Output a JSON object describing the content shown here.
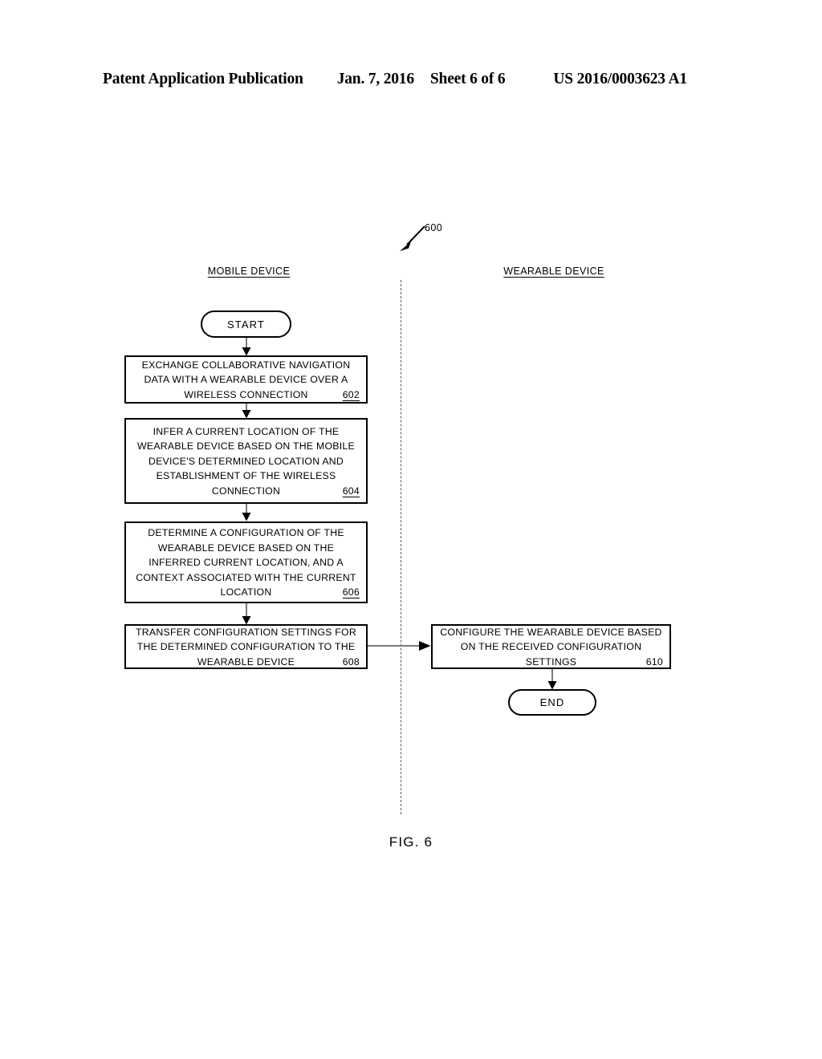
{
  "page_header": {
    "publication": "Patent Application Publication",
    "date": "Jan. 7, 2016",
    "sheet": "Sheet 6 of 6",
    "publication_number": "US 2016/0003623 A1"
  },
  "figure": {
    "caption": "FIG. 6",
    "reference_numeral": "600",
    "colors": {
      "stroke": "#000000",
      "connector": "#7a7a7a",
      "divider": "#5b5b5b",
      "background": "#ffffff"
    }
  },
  "lanes": [
    {
      "id": "mobile",
      "title": "MOBILE DEVICE"
    },
    {
      "id": "wearable",
      "title": "WEARABLE DEVICE"
    }
  ],
  "terminals": {
    "start": "START",
    "end": "END"
  },
  "steps": [
    {
      "ref": "602",
      "lane": "mobile",
      "lines": [
        "EXCHANGE COLLABORATIVE NAVIGATION",
        "DATA WITH A WEARABLE DEVICE OVER A"
      ],
      "last_line": "WIRELESS CONNECTION",
      "full_text": "EXCHANGE COLLABORATIVE NAVIGATION DATA WITH A WEARABLE DEVICE OVER A WIRELESS CONNECTION"
    },
    {
      "ref": "604",
      "lane": "mobile",
      "lines": [
        "INFER A CURRENT LOCATION OF THE",
        "WEARABLE DEVICE BASED ON THE MOBILE",
        "DEVICE'S DETERMINED LOCATION AND",
        "ESTABLISHMENT OF THE WIRELESS"
      ],
      "last_line": "CONNECTION",
      "full_text": "INFER A CURRENT LOCATION OF THE WEARABLE DEVICE BASED ON THE MOBILE DEVICE'S DETERMINED LOCATION AND ESTABLISHMENT OF THE WIRELESS CONNECTION"
    },
    {
      "ref": "606",
      "lane": "mobile",
      "lines": [
        "DETERMINE A CONFIGURATION OF THE",
        "WEARABLE DEVICE BASED ON THE",
        "INFERRED CURRENT LOCATION, AND A",
        "CONTEXT ASSOCIATED WITH THE CURRENT"
      ],
      "last_line": "LOCATION",
      "full_text": "DETERMINE A CONFIGURATION OF THE WEARABLE DEVICE BASED ON THE INFERRED CURRENT LOCATION, AND A CONTEXT ASSOCIATED WITH THE CURRENT LOCATION"
    },
    {
      "ref": "608",
      "lane": "mobile",
      "lines": [
        "TRANSFER CONFIGURATION SETTINGS FOR",
        "THE DETERMINED CONFIGURATION TO THE"
      ],
      "last_line": "WEARABLE DEVICE",
      "full_text": "TRANSFER CONFIGURATION SETTINGS FOR THE DETERMINED CONFIGURATION TO THE WEARABLE DEVICE"
    },
    {
      "ref": "610",
      "lane": "wearable",
      "lines": [
        "CONFIGURE THE WEARABLE DEVICE BASED",
        "ON THE RECEIVED CONFIGURATION"
      ],
      "last_line": "SETTINGS",
      "full_text": "CONFIGURE THE WEARABLE DEVICE BASED ON THE RECEIVED CONFIGURATION SETTINGS"
    }
  ],
  "connectors": [
    {
      "from": "start",
      "to": "602",
      "direction": "down"
    },
    {
      "from": "602",
      "to": "604",
      "direction": "down"
    },
    {
      "from": "604",
      "to": "606",
      "direction": "down"
    },
    {
      "from": "606",
      "to": "608",
      "direction": "down"
    },
    {
      "from": "608",
      "to": "610",
      "direction": "right"
    },
    {
      "from": "610",
      "to": "end",
      "direction": "down"
    }
  ]
}
